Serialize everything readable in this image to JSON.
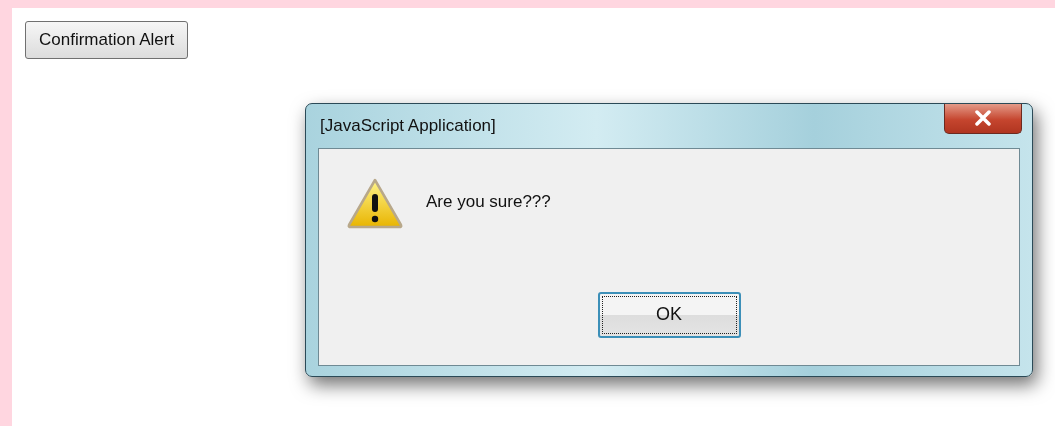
{
  "page_button": {
    "label": "Confirmation Alert"
  },
  "dialog": {
    "title": "[JavaScript Application]",
    "message": "Are you sure???",
    "buttons": [
      {
        "label": "OK",
        "focused": true
      }
    ]
  }
}
